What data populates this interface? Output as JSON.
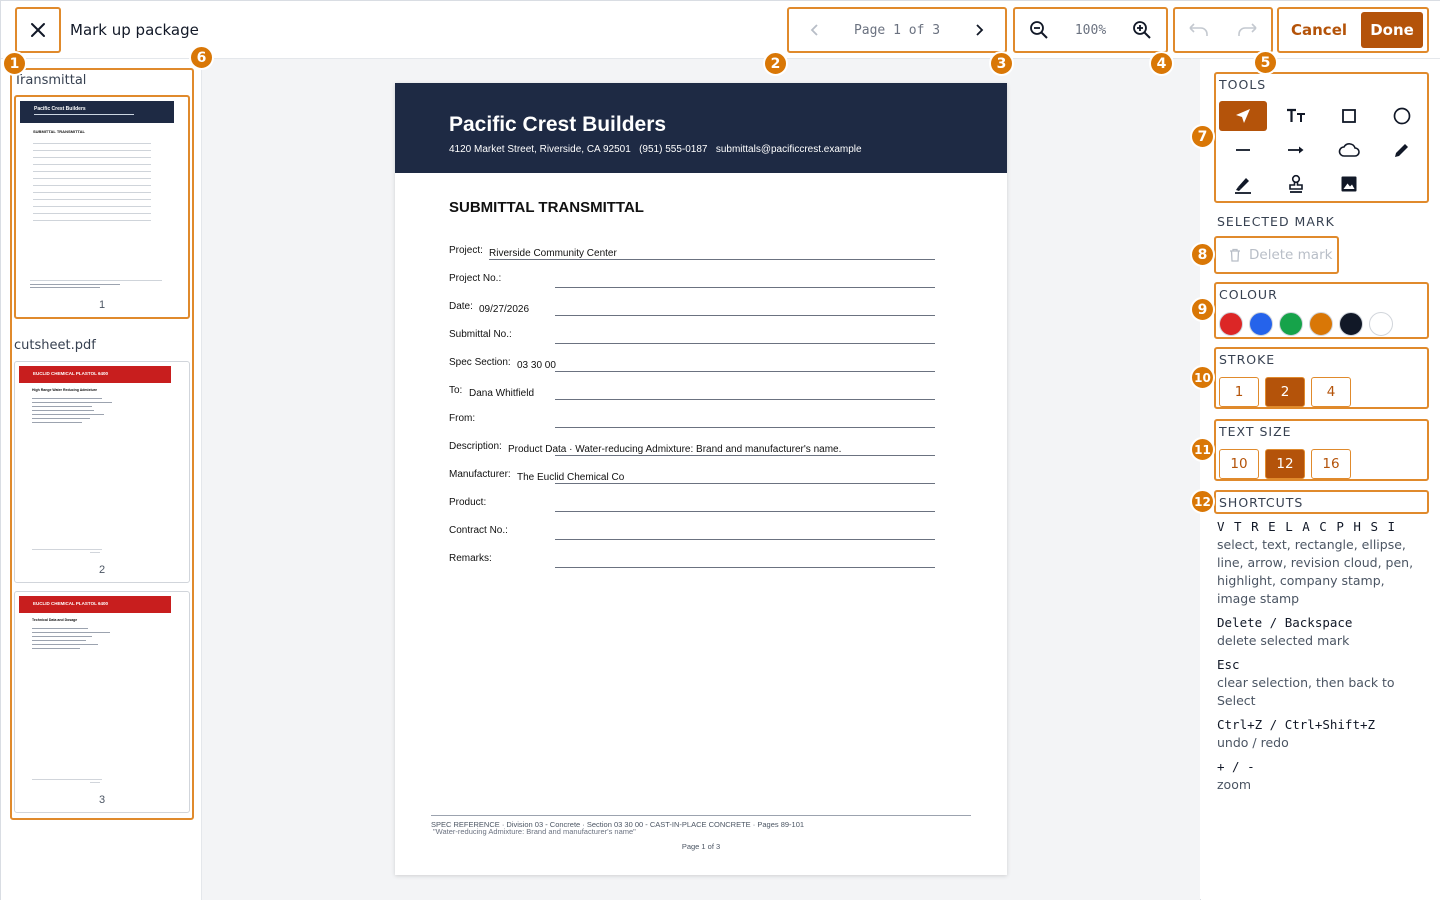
{
  "header": {
    "title": "Mark up package",
    "page_indicator": "Page 1 of 3",
    "zoom_level": "100%",
    "cancel_label": "Cancel",
    "done_label": "Done"
  },
  "badges": [
    "1",
    "2",
    "3",
    "4",
    "5",
    "6",
    "7",
    "8",
    "9",
    "10",
    "11",
    "12"
  ],
  "sidebar": {
    "groups": [
      {
        "label": "Transmittal",
        "pages": [
          {
            "number": "1"
          }
        ]
      },
      {
        "label": "cutsheet.pdf",
        "pages": [
          {
            "number": "2"
          },
          {
            "number": "3"
          }
        ]
      }
    ]
  },
  "document": {
    "company": "Pacific Crest Builders",
    "address": "4120 Market Street, Riverside, CA 92501   (951) 555-0187   submittals@pacificcrest.example",
    "title": "SUBMITTAL TRANSMITTAL",
    "fields": [
      {
        "label": "Project:",
        "value": "Riverside Community Center"
      },
      {
        "label": "Project No.:",
        "value": ""
      },
      {
        "label": "Date:",
        "value": "09/27/2026"
      },
      {
        "label": "Submittal No.:",
        "value": ""
      },
      {
        "label": "Spec Section:",
        "value": "03 30 00"
      },
      {
        "label": "To:",
        "value": "Dana Whitfield"
      },
      {
        "label": "From:",
        "value": ""
      },
      {
        "label": "Description:",
        "value": "Product Data · Water-reducing Admixture: Brand and manufacturer's name."
      },
      {
        "label": "Manufacturer:",
        "value": "The Euclid Chemical Co"
      },
      {
        "label": "Product:",
        "value": ""
      },
      {
        "label": "Contract No.:",
        "value": ""
      },
      {
        "label": "Remarks:",
        "value": ""
      }
    ],
    "footer_spec": "SPEC REFERENCE · Division 03 - Concrete · Section 03 30 00 - CAST-IN-PLACE CONCRETE · Pages 89-101",
    "footer_note": "\"Water-reducing Admixture: Brand and manufacturer's name\"",
    "footer_page": "Page 1 of 3"
  },
  "thumbnails": {
    "cutsheet_banner": "EUCLID CHEMICAL   PLASTOL 6400",
    "cutsheet_p2_heading": "High Range Water Reducing Admixture",
    "cutsheet_p3_heading": "Technical Data and Dosage"
  },
  "panel": {
    "tools_label": "TOOLS",
    "tools": [
      {
        "name": "select",
        "icon": "cursor-arrow-icon",
        "active": true
      },
      {
        "name": "text",
        "icon": "text-size-icon"
      },
      {
        "name": "rectangle",
        "icon": "square-icon"
      },
      {
        "name": "ellipse",
        "icon": "circle-icon"
      },
      {
        "name": "line",
        "icon": "line-icon"
      },
      {
        "name": "arrow",
        "icon": "arrow-right-icon"
      },
      {
        "name": "revision cloud",
        "icon": "cloud-icon"
      },
      {
        "name": "pen",
        "icon": "pen-icon"
      },
      {
        "name": "highlight",
        "icon": "highlighter-icon"
      },
      {
        "name": "company stamp",
        "icon": "stamp-icon"
      },
      {
        "name": "image stamp",
        "icon": "image-icon"
      }
    ],
    "selected_mark_label": "SELECTED MARK",
    "delete_label": "Delete mark",
    "colour_label": "COLOUR",
    "colours": [
      "#dc2626",
      "#2563eb",
      "#16a34a",
      "#d97706",
      "#111827",
      "#ffffff"
    ],
    "stroke_label": "STROKE",
    "strokes": [
      "1",
      "2",
      "4"
    ],
    "stroke_selected": "2",
    "text_size_label": "TEXT SIZE",
    "text_sizes": [
      "10",
      "12",
      "16"
    ],
    "text_size_selected": "12",
    "shortcuts_label": "SHORTCUTS",
    "shortcuts": [
      {
        "keys": "V T R E L A C P H S I",
        "desc": "select, text, rectangle, ellipse, line, arrow, revision cloud, pen, highlight, company stamp, image stamp"
      },
      {
        "keys": "Delete / Backspace",
        "desc": "delete selected mark"
      },
      {
        "keys": "Esc",
        "desc": "clear selection, then back to Select"
      },
      {
        "keys": "Ctrl+Z / Ctrl+Shift+Z",
        "desc": "undo / redo"
      },
      {
        "keys": "+ / -",
        "desc": "zoom"
      }
    ]
  }
}
